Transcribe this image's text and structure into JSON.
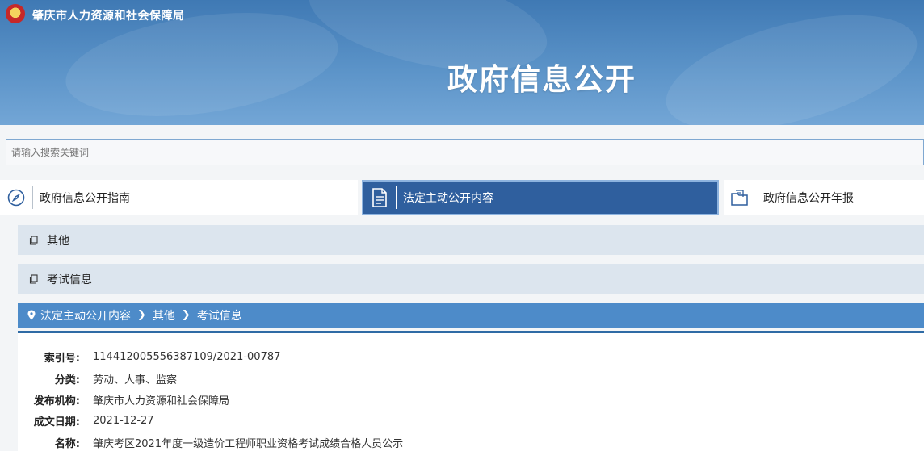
{
  "header": {
    "site_name": "肇庆市人力资源和社会保障局",
    "page_title": "政府信息公开"
  },
  "search": {
    "placeholder": "请输入搜索关键词"
  },
  "tabs": [
    {
      "label": "政府信息公开指南",
      "icon": "compass-icon"
    },
    {
      "label": "法定主动公开内容",
      "icon": "document-icon",
      "active": true
    },
    {
      "label": "政府信息公开年报",
      "icon": "report-folder-icon"
    }
  ],
  "categories": [
    {
      "label": "其他",
      "icon": "copy-icon"
    },
    {
      "label": "考试信息",
      "icon": "copy-icon"
    }
  ],
  "breadcrumb": {
    "items": [
      "法定主动公开内容",
      "其他",
      "考试信息"
    ]
  },
  "details": [
    {
      "key": "索引号:",
      "value": "114412005556387109/2021-00787"
    },
    {
      "key": "分类:",
      "value": "劳动、人事、监察"
    },
    {
      "key": "发布机构:",
      "value": "肇庆市人力资源和社会保障局"
    },
    {
      "key": "成文日期:",
      "value": "2021-12-27"
    },
    {
      "key": "名称:",
      "value": "肇庆考区2021年度一级造价工程师职业资格考试成绩合格人员公示"
    }
  ],
  "colors": {
    "banner": "#4f88c0",
    "active_tab": "#2f5f9e",
    "breadcrumb_bar": "#4d8bc9",
    "category_bg": "#dce5ee"
  }
}
